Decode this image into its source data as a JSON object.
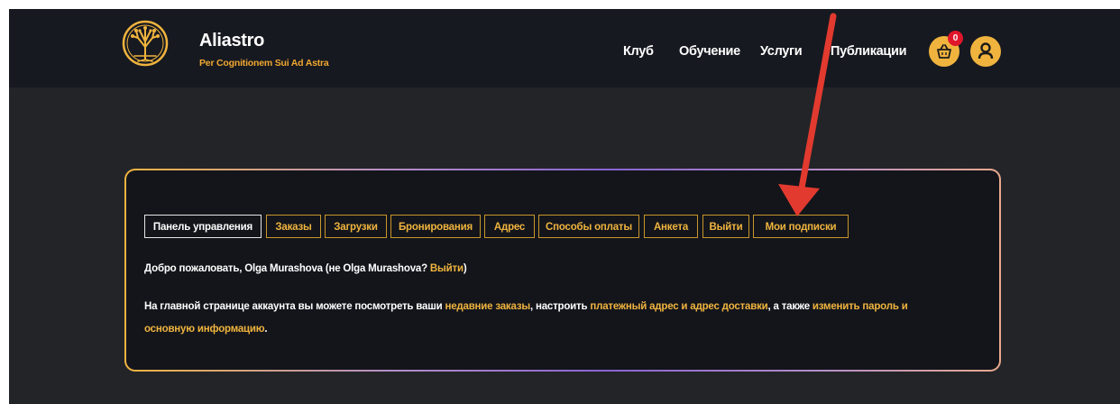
{
  "brand": {
    "title": "Aliastro",
    "subtitle": "Per Cognitionem Sui Ad Astra"
  },
  "nav": {
    "items": [
      "Клуб",
      "Обучение",
      "Услуги",
      "Публикации"
    ]
  },
  "cart": {
    "count": "0"
  },
  "colors": {
    "accent": "#f0b43e",
    "header_bg": "#171920",
    "page_bg": "#232427",
    "badge": "#e0162b",
    "annotation_arrow": "#e23a2f"
  },
  "icons": {
    "logo": "tree-of-life-logo",
    "cart": "basket-icon",
    "account": "user-icon"
  },
  "account": {
    "tabs": [
      "Панель управления",
      "Заказы",
      "Загрузки",
      "Бронирования",
      "Адрес",
      "Способы оплаты",
      "Анкета",
      "Выйти",
      "Мои подписки"
    ],
    "welcome": {
      "prefix": "Добро пожаловать, Olga Murashova (не Olga Murashova? ",
      "logout_link": "Выйти",
      "suffix": ")"
    },
    "description": {
      "text1": "На главной странице аккаунта вы можете посмотреть ваши ",
      "link_orders": "недавние заказы",
      "text2": ", настроить ",
      "link_address": "платежный адрес и адрес доставки",
      "text3": ", а также ",
      "link_password": "изменить пароль и",
      "link_password_cont": "основную информацию",
      "text4": "."
    }
  }
}
